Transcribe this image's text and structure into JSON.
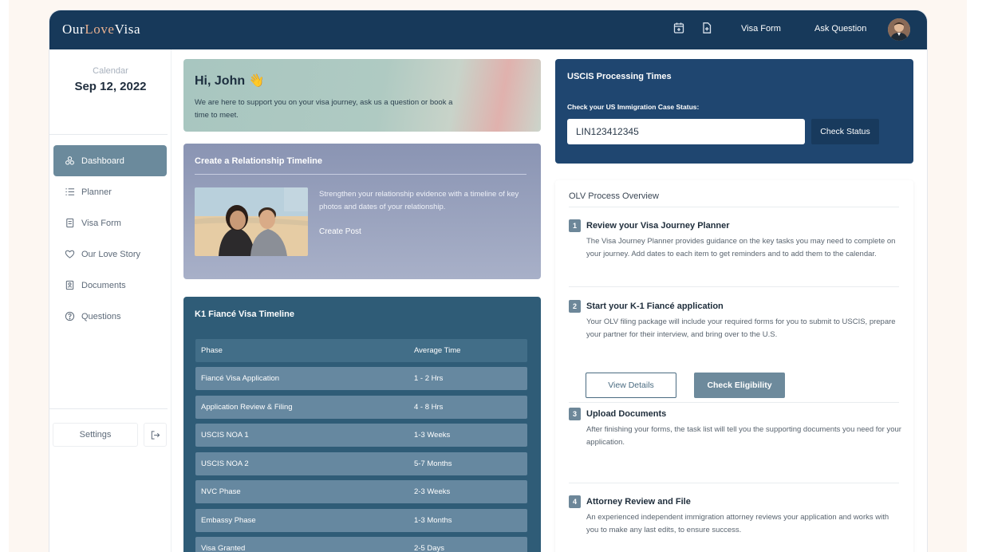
{
  "app": {
    "logo_prefix": "Our",
    "logo_accent": "Love",
    "logo_suffix": "Visa"
  },
  "topbar": {
    "visa_form": "Visa Form",
    "ask_question": "Ask Question",
    "icons": [
      "calendar-add-icon",
      "document-add-icon"
    ]
  },
  "sidebar": {
    "calendar_label": "Calendar",
    "calendar_date": "Sep 12, 2022",
    "items": [
      {
        "label": "Dashboard",
        "icon": "dashboard-icon",
        "active": true
      },
      {
        "label": "Planner",
        "icon": "list-icon"
      },
      {
        "label": "Visa Form",
        "icon": "form-icon"
      },
      {
        "label": "Our Love Story",
        "icon": "heart-icon"
      },
      {
        "label": "Documents",
        "icon": "documents-icon"
      },
      {
        "label": "Questions",
        "icon": "question-icon"
      }
    ],
    "settings": "Settings"
  },
  "greeting": {
    "title": "Hi, John 👋",
    "text": "We are here to support you on your visa journey, ask us a question or book a time to meet."
  },
  "timeline_card": {
    "title": "Create a Relationship Timeline",
    "text": "Strengthen your relationship evidence with a timeline of key photos and dates of your relationship.",
    "link": "Create Post"
  },
  "k1": {
    "title": "K1 Fiancé Visa Timeline",
    "headers": [
      "Phase",
      "Average Time"
    ],
    "rows": [
      [
        "Fiancé Visa Application",
        "1 - 2 Hrs"
      ],
      [
        "Application Review & Filing",
        "4 - 8 Hrs"
      ],
      [
        "USCIS NOA 1",
        "1-3 Weeks"
      ],
      [
        "USCIS NOA 2",
        "5-7 Months"
      ],
      [
        "NVC Phase",
        "2-3 Weeks"
      ],
      [
        "Embassy Phase",
        "1-3 Months"
      ],
      [
        "Visa Granted",
        "2-5 Days"
      ]
    ]
  },
  "uscis": {
    "title": "USCIS Processing Times",
    "label": "Check your US Immigration Case Status:",
    "input_value": "LIN123412345",
    "button": "Check Status"
  },
  "olv": {
    "title": "OLV Process Overview",
    "steps": [
      {
        "num": "1",
        "title": "Review your Visa Journey Planner",
        "text": "The Visa Journey Planner provides guidance on the key tasks you may need to complete on your journey. Add dates to each item to get reminders and to add them to the calendar."
      },
      {
        "num": "2",
        "title": "Start your K-1 Fiancé application",
        "text": "Your OLV filing package will include your required forms for you to submit to USCIS, prepare your partner for their interview, and bring over to the U.S."
      },
      {
        "num": "3",
        "title": "Upload Documents",
        "text": "After finishing your forms, the task list will tell you the supporting documents you need for your application."
      },
      {
        "num": "4",
        "title": "Attorney Review and File",
        "text": "An experienced independent immigration attorney reviews your application and works with you to make any last edits, to ensure success."
      }
    ],
    "view_details": "View Details",
    "check_eligibility": "Check Eligibility"
  }
}
